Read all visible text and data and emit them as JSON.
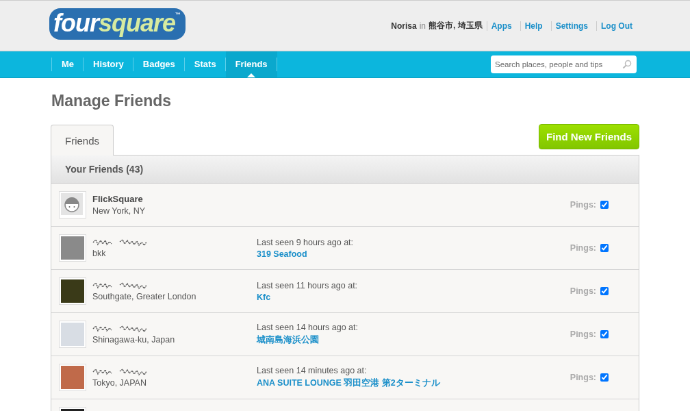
{
  "logo": {
    "parts": [
      "four",
      "square"
    ],
    "mark": "™"
  },
  "user_bar": {
    "user": "Norisa",
    "in_word": "in",
    "location": "熊谷市, 埼玉県",
    "links": [
      "Apps",
      "Help",
      "Settings",
      "Log Out"
    ]
  },
  "nav": {
    "items": [
      {
        "label": "Me",
        "selected": false
      },
      {
        "label": "History",
        "selected": false
      },
      {
        "label": "Badges",
        "selected": false
      },
      {
        "label": "Stats",
        "selected": false
      },
      {
        "label": "Friends",
        "selected": true
      }
    ],
    "search": {
      "placeholder": "Search places, people and tips"
    }
  },
  "page_title": "Manage Friends",
  "tabs": [
    {
      "label": "Friends",
      "selected": true
    }
  ],
  "find_button": "Find New Friends",
  "panel_title": "Your Friends (43)",
  "friends": [
    {
      "kind": "default",
      "name": "FlickSquare",
      "location": "New York, NY",
      "pings_label": "Pings:",
      "pings": true
    },
    {
      "kind": "photo",
      "color": "#8a8a8a",
      "location": "bkk",
      "last_seen": "Last seen 9 hours ago at:",
      "venue": "319 Seafood",
      "pings_label": "Pings:",
      "pings": true
    },
    {
      "kind": "photo",
      "color": "#3a3a18",
      "location": "Southgate, Greater London",
      "last_seen": "Last seen 11 hours ago at:",
      "venue": "Kfc",
      "pings_label": "Pings:",
      "pings": true
    },
    {
      "kind": "photo",
      "color": "#d8dde4",
      "location": "Shinagawa-ku, Japan",
      "last_seen": "Last seen 14 hours ago at:",
      "venue": "城南島海浜公園",
      "pings_label": "Pings:",
      "pings": true
    },
    {
      "kind": "photo",
      "color": "#c06a4a",
      "location": "Tokyo, JAPAN",
      "last_seen": "Last seen 14 minutes ago at:",
      "venue": "ANA SUITE LOUNGE 羽田空港 第2ターミナル",
      "pings_label": "Pings:",
      "pings": true
    },
    {
      "kind": "photo",
      "color": "#222222"
    }
  ]
}
